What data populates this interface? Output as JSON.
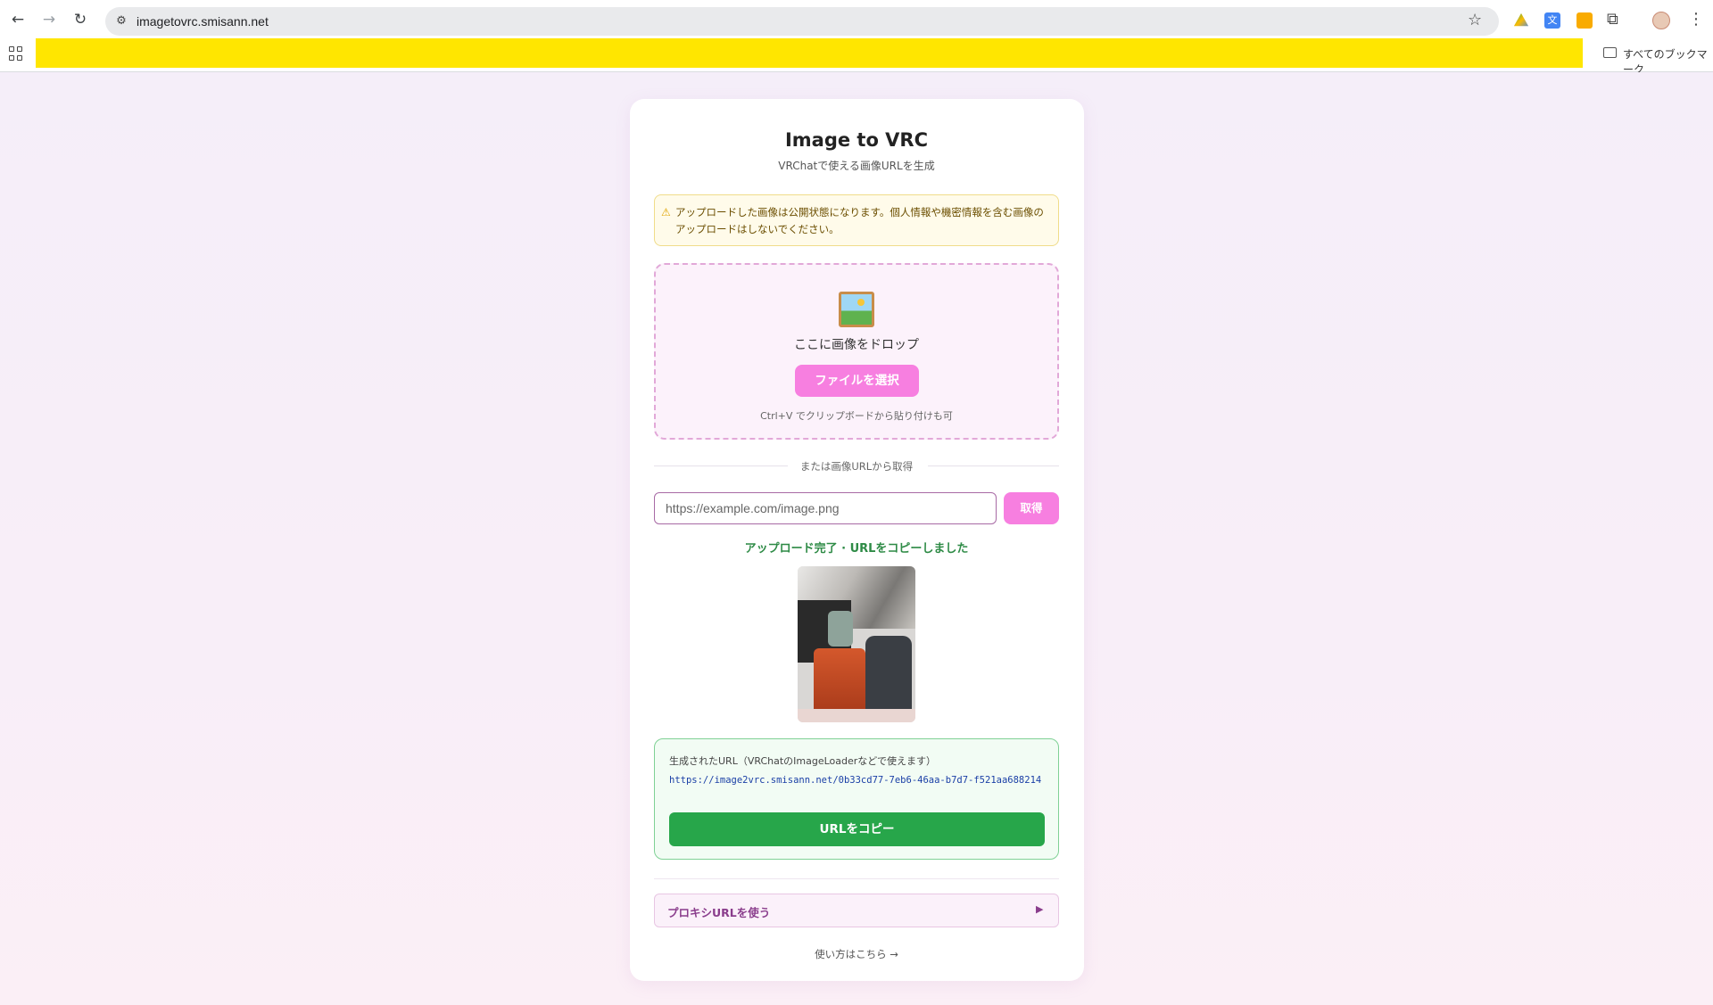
{
  "browser": {
    "url": "imagetovrc.smisann.net",
    "bookmarks_label": "すべてのブックマーク"
  },
  "app": {
    "title": "Image to VRC",
    "subtitle": "VRChatで使える画像URLを生成"
  },
  "warning": {
    "text": "アップロードした画像は公開状態になります。個人情報や機密情報を含む画像のアップロードはしないでください。"
  },
  "dropzone": {
    "label": "ここに画像をドロップ",
    "select_button": "ファイルを選択",
    "paste_hint": "Ctrl+V でクリップボードから貼り付けも可"
  },
  "url_fetch": {
    "divider": "または画像URLから取得",
    "placeholder": "https://example.com/image.png",
    "button": "取得"
  },
  "status": {
    "message": "アップロード完了 · URLをコピーしました"
  },
  "result": {
    "label": "生成されたURL（VRChatのImageLoaderなどで使えます）",
    "url": "https://image2vrc.smisann.net/0b33cd77-7eb6-46aa-b7d7-f521aa688214",
    "copy_button": "URLをコピー"
  },
  "proxy": {
    "label": "プロキシURLを使う",
    "arrow": "▶"
  },
  "footer": {
    "howto": "使い方はこちら →"
  }
}
